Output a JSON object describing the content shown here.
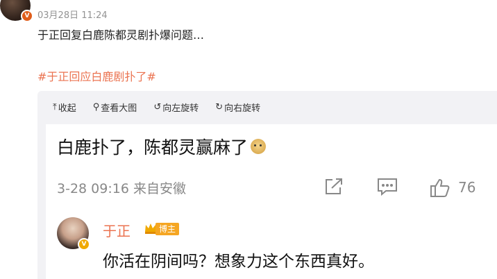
{
  "post": {
    "time": "03月28日 11:24",
    "text": "于正回复白鹿陈都灵剧扑爆问题…",
    "tag": "#于正回应白鹿剧扑了#"
  },
  "viewer": {
    "toolbar": [
      {
        "icon": "collapse-icon",
        "glyph": "⤒",
        "label": "收起"
      },
      {
        "icon": "search-icon",
        "glyph": "⚲",
        "label": "查看大图"
      },
      {
        "icon": "rotate-left-icon",
        "glyph": "↺",
        "label": "向左旋转"
      },
      {
        "icon": "rotate-right-icon",
        "glyph": "↻",
        "label": "向右旋转"
      }
    ]
  },
  "screenshot": {
    "headline": "白鹿扑了，陈都灵赢麻了",
    "meta": "3-28 09:16 来自安徽",
    "like_count": "76",
    "comment": {
      "name": "于正",
      "badge": "博主",
      "text": "你活在阴间吗？想象力这个东西真好。"
    }
  },
  "colors": {
    "accent": "#eb7350",
    "muted": "#939393",
    "panel_bg": "#f2f2f5"
  }
}
